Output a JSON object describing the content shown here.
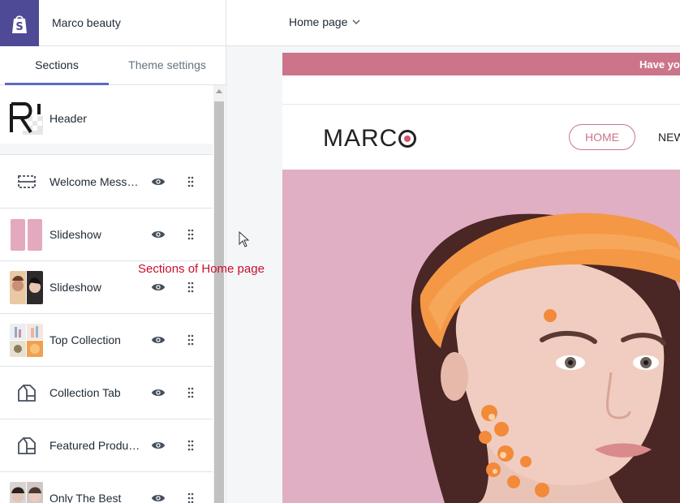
{
  "topbar": {
    "store_name": "Marco beauty",
    "page_selector": "Home page"
  },
  "sidebar": {
    "tabs": [
      {
        "label": "Sections",
        "active": true
      },
      {
        "label": "Theme settings",
        "active": false
      }
    ],
    "header_section": {
      "label": "Header"
    },
    "sections": [
      {
        "label": "Welcome Message",
        "visible": true
      },
      {
        "label": "Slideshow",
        "visible": true
      },
      {
        "label": "Slideshow",
        "visible": true
      },
      {
        "label": "Top Collection",
        "visible": true
      },
      {
        "label": "Collection Tab",
        "visible": true
      },
      {
        "label": "Featured Products",
        "visible": true
      },
      {
        "label": "Only The Best",
        "visible": true
      }
    ]
  },
  "annotation": {
    "text": "Sections of Home page"
  },
  "preview": {
    "announcement": "Have yo",
    "brand": {
      "prefix": "MARC"
    },
    "nav": [
      {
        "label": "HOME"
      },
      {
        "label": "NEW"
      }
    ]
  },
  "colors": {
    "shopify_purple": "#4f4a96",
    "tab_active": "#5c6ac4",
    "announcement_pink": "#cc7489",
    "hero_pink": "#e1afc4",
    "annotation_red": "#c8102e"
  }
}
